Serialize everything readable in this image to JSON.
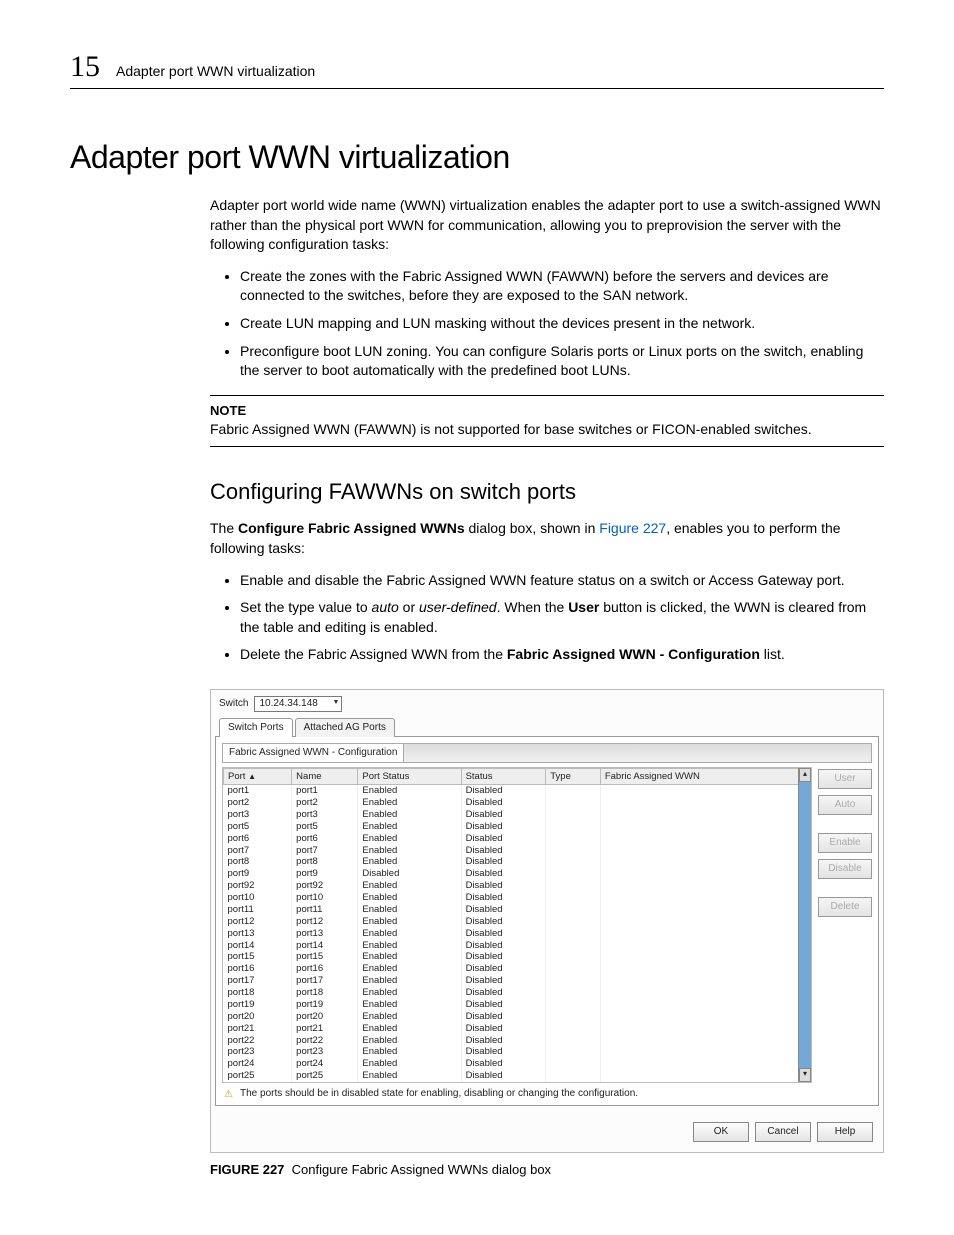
{
  "runningHead": {
    "chapter": "15",
    "title": "Adapter port WWN virtualization"
  },
  "h1": "Adapter port WWN virtualization",
  "intro": "Adapter port world wide name (WWN) virtualization enables the adapter port to use a switch-assigned WWN rather than the physical port WWN for communication, allowing you to preprovision the server with the following configuration tasks:",
  "bullets1": [
    "Create the zones with the Fabric Assigned WWN (FAWWN) before the servers and devices are connected to the switches, before they are exposed to the SAN network.",
    "Create LUN mapping and LUN masking without the devices present in the network.",
    "Preconfigure boot LUN zoning. You can configure Solaris ports or Linux ports on the switch, enabling the server to boot automatically with the predefined boot LUNs."
  ],
  "note": {
    "label": "NOTE",
    "text": "Fabric Assigned WWN (FAWWN) is not supported for base switches or FICON-enabled switches."
  },
  "h2": "Configuring FAWWNs on switch ports",
  "p2_pre": "The ",
  "p2_bold": "Configure Fabric Assigned WWNs",
  "p2_mid": " dialog box, shown in ",
  "p2_link": "Figure 227",
  "p2_post": ", enables you to perform the following tasks:",
  "bullets2": {
    "b1": "Enable and disable the Fabric Assigned WWN feature status on a switch or Access Gateway port.",
    "b2_pre": "Set the type value to ",
    "b2_i1": "auto",
    "b2_or": " or ",
    "b2_i2": "user-defined",
    "b2_mid": ". When the ",
    "b2_bold": "User",
    "b2_post": " button is clicked, the WWN is cleared from the table and editing is enabled.",
    "b3_pre": "Delete the Fabric Assigned WWN from the ",
    "b3_bold": "Fabric Assigned WWN - Configuration",
    "b3_post": " list."
  },
  "dialog": {
    "switchLabel": "Switch",
    "switchValue": "10.24.34.148",
    "tabs": {
      "t1": "Switch Ports",
      "t2": "Attached AG Ports"
    },
    "configTitle": "Fabric Assigned WWN - Configuration",
    "columns": {
      "port": "Port",
      "name": "Name",
      "portStatus": "Port Status",
      "status": "Status",
      "type": "Type",
      "fawwn": "Fabric Assigned WWN"
    },
    "sideButtons": {
      "user": "User",
      "auto": "Auto",
      "enable": "Enable",
      "disable": "Disable",
      "delete": "Delete"
    },
    "rows": [
      {
        "port": "port1",
        "name": "port1",
        "ps": "Enabled",
        "st": "Disabled"
      },
      {
        "port": "port2",
        "name": "port2",
        "ps": "Enabled",
        "st": "Disabled"
      },
      {
        "port": "port3",
        "name": "port3",
        "ps": "Enabled",
        "st": "Disabled"
      },
      {
        "port": "port5",
        "name": "port5",
        "ps": "Enabled",
        "st": "Disabled"
      },
      {
        "port": "port6",
        "name": "port6",
        "ps": "Enabled",
        "st": "Disabled"
      },
      {
        "port": "port7",
        "name": "port7",
        "ps": "Enabled",
        "st": "Disabled"
      },
      {
        "port": "port8",
        "name": "port8",
        "ps": "Enabled",
        "st": "Disabled"
      },
      {
        "port": "port9",
        "name": "port9",
        "ps": "Disabled",
        "st": "Disabled"
      },
      {
        "port": "port92",
        "name": "port92",
        "ps": "Enabled",
        "st": "Disabled"
      },
      {
        "port": "port10",
        "name": "port10",
        "ps": "Enabled",
        "st": "Disabled"
      },
      {
        "port": "port11",
        "name": "port11",
        "ps": "Enabled",
        "st": "Disabled"
      },
      {
        "port": "port12",
        "name": "port12",
        "ps": "Enabled",
        "st": "Disabled"
      },
      {
        "port": "port13",
        "name": "port13",
        "ps": "Enabled",
        "st": "Disabled"
      },
      {
        "port": "port14",
        "name": "port14",
        "ps": "Enabled",
        "st": "Disabled"
      },
      {
        "port": "port15",
        "name": "port15",
        "ps": "Enabled",
        "st": "Disabled"
      },
      {
        "port": "port16",
        "name": "port16",
        "ps": "Enabled",
        "st": "Disabled"
      },
      {
        "port": "port17",
        "name": "port17",
        "ps": "Enabled",
        "st": "Disabled"
      },
      {
        "port": "port18",
        "name": "port18",
        "ps": "Enabled",
        "st": "Disabled"
      },
      {
        "port": "port19",
        "name": "port19",
        "ps": "Enabled",
        "st": "Disabled"
      },
      {
        "port": "port20",
        "name": "port20",
        "ps": "Enabled",
        "st": "Disabled"
      },
      {
        "port": "port21",
        "name": "port21",
        "ps": "Enabled",
        "st": "Disabled"
      },
      {
        "port": "port22",
        "name": "port22",
        "ps": "Enabled",
        "st": "Disabled"
      },
      {
        "port": "port23",
        "name": "port23",
        "ps": "Enabled",
        "st": "Disabled"
      },
      {
        "port": "port24",
        "name": "port24",
        "ps": "Enabled",
        "st": "Disabled"
      },
      {
        "port": "port25",
        "name": "port25",
        "ps": "Enabled",
        "st": "Disabled"
      }
    ],
    "warning": "The ports should be in disabled state for enabling, disabling or changing the configuration.",
    "buttons": {
      "ok": "OK",
      "cancel": "Cancel",
      "help": "Help"
    }
  },
  "figcaption": {
    "label": "FIGURE 227",
    "text": "Configure Fabric Assigned WWNs dialog box"
  }
}
